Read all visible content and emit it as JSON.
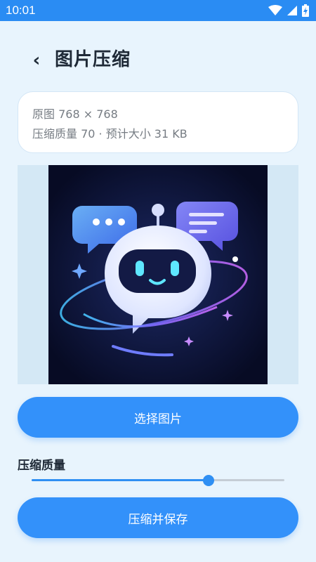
{
  "status_bar": {
    "time": "10:01",
    "icons": [
      "wifi-icon",
      "signal-icon",
      "battery-charging-icon"
    ]
  },
  "header": {
    "back_icon": "chevron-left-icon",
    "back_glyph": "‹",
    "title": "图片压缩"
  },
  "info": {
    "original": "原图 768 × 768",
    "compressed": "压缩质量 70 · 预计大小 31 KB"
  },
  "preview": {
    "image_subject": "robot-chat-illustration"
  },
  "buttons": {
    "select_label": "选择图片",
    "save_label": "压缩并保存"
  },
  "quality": {
    "label": "压缩质量",
    "value": 70
  },
  "colors": {
    "accent": "#3391fa",
    "status_bar": "#2a8cf3",
    "background": "#e8f4fd"
  }
}
